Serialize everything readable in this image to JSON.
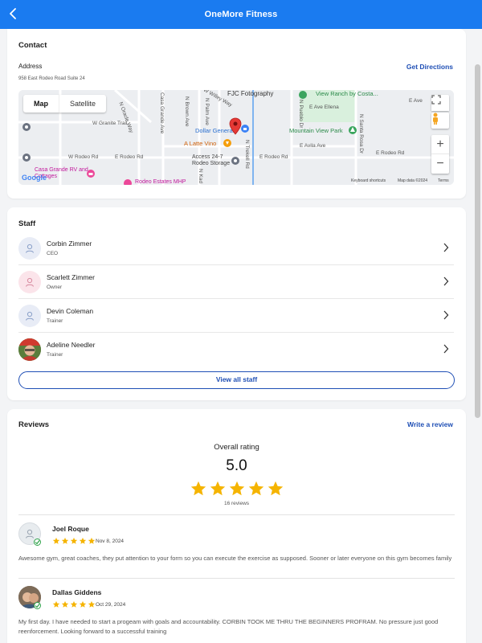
{
  "app": {
    "title": "OneMore Fitness"
  },
  "colors": {
    "brand": "#1a7bf0",
    "link": "#1f4fb5",
    "star": "#f5b400",
    "verified": "#2fa34a"
  },
  "contact": {
    "title": "Contact",
    "address_label": "Address",
    "address": "958 East Rodeo Road Suite 24",
    "directions_link": "Get Directions",
    "map": {
      "toggle_map": "Map",
      "toggle_satellite": "Satellite",
      "zoom_in": "+",
      "zoom_out": "−",
      "labels": {
        "w_willey": "W Willey Way",
        "n_oracle": "N Oracle Way",
        "casa_grande_ave": "Casa Grande Ave",
        "n_brown_ave": "N Brown Ave",
        "n_palm_ave": "N Palm Ave",
        "fjc": "FJC Fotography",
        "n_pueblo": "N Pueblo Dr",
        "view_ranch": "View Ranch by Costa...",
        "e_ave_ellena": "E Ave Ellena",
        "e_ave": "E Ave",
        "w_granite": "W Granite Trail",
        "dollar": "Dollar General",
        "mountain_view": "Mountain View Park",
        "n_santa_rosa": "N Santa Rosa Dr",
        "a_latte": "A Latte Vino",
        "n_trekell": "N Trekell Rd",
        "e_avila": "E Avila Ave",
        "w_rodeo": "W Rodeo Rd",
        "e_rodeo_1": "E Rodeo Rd",
        "access": "Access 24-7 Rodeo Storage",
        "e_rodeo_2": "E Rodeo Rd",
        "e_rodeo_3": "E Rodeo Rd",
        "casa_grande_rv": "Casa Grande RV and Cottages",
        "rodeo_estates": "Rodeo Estates MHP",
        "n_kad": "N Kad"
      },
      "keyboard": "Keyboard shortcuts",
      "map_data": "Map data ©2024",
      "terms": "Terms",
      "google": "Google"
    }
  },
  "staff": {
    "title": "Staff",
    "members": [
      {
        "name": "Corbin Zimmer",
        "role": "CEO"
      },
      {
        "name": "Scarlett Zimmer",
        "role": "Owner"
      },
      {
        "name": "Devin Coleman",
        "role": "Trainer"
      },
      {
        "name": "Adeline Needler",
        "role": "Trainer"
      }
    ],
    "view_all": "View all staff"
  },
  "reviews": {
    "title": "Reviews",
    "write_link": "Write a review",
    "overall_title": "Overall rating",
    "overall_value": "5.0",
    "overall_stars": 5,
    "count": "16 reviews",
    "items": [
      {
        "name": "Joel Roque",
        "stars": 5,
        "date": "Nov 8, 2024",
        "text": "Awesome gym, great coaches, they put attention to your form so you can execute the exercise as supposed. Sooner or later everyone on this gym becomes family"
      },
      {
        "name": "Dallas Giddens",
        "stars": 5,
        "date": "Oct 29, 2024",
        "text": "My first day. I have needed to start a progeam with goals and accountability. CORBIN TOOK ME THRU THE BEGINNERS PROFRAM. No pressure just good reenforcement. Looking forward to a successful training"
      }
    ]
  }
}
